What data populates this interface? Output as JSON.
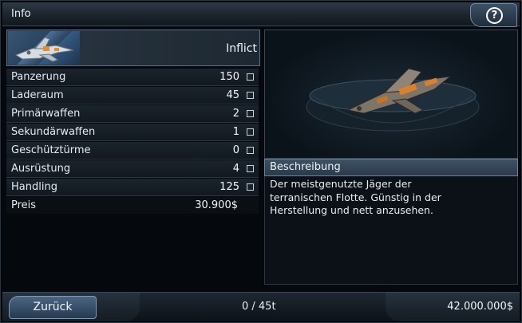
{
  "window": {
    "title": "Info"
  },
  "ship": {
    "name": "Inflict"
  },
  "stats": [
    {
      "label": "Panzerung",
      "value": "150"
    },
    {
      "label": "Laderaum",
      "value": "45"
    },
    {
      "label": "Primärwaffen",
      "value": "2"
    },
    {
      "label": "Sekundärwaffen",
      "value": "1"
    },
    {
      "label": "Geschütztürme",
      "value": "0"
    },
    {
      "label": "Ausrüstung",
      "value": "4"
    },
    {
      "label": "Handling",
      "value": "125"
    }
  ],
  "price": {
    "label": "Preis",
    "value": "30.900$"
  },
  "description": {
    "header": "Beschreibung",
    "lines": [
      "Der meistgenutzte Jäger der",
      "terranischen Flotte. Günstig in der",
      "Herstellung und nett anzusehen."
    ]
  },
  "footer": {
    "back_label": "Zurück",
    "cargo": "0 / 45t",
    "credits": "42.000.000$"
  },
  "icons": {
    "help": "question-icon"
  },
  "colors": {
    "accent": "#4b6682",
    "panel": "#1b232c",
    "ship_orange": "#d9822b"
  }
}
